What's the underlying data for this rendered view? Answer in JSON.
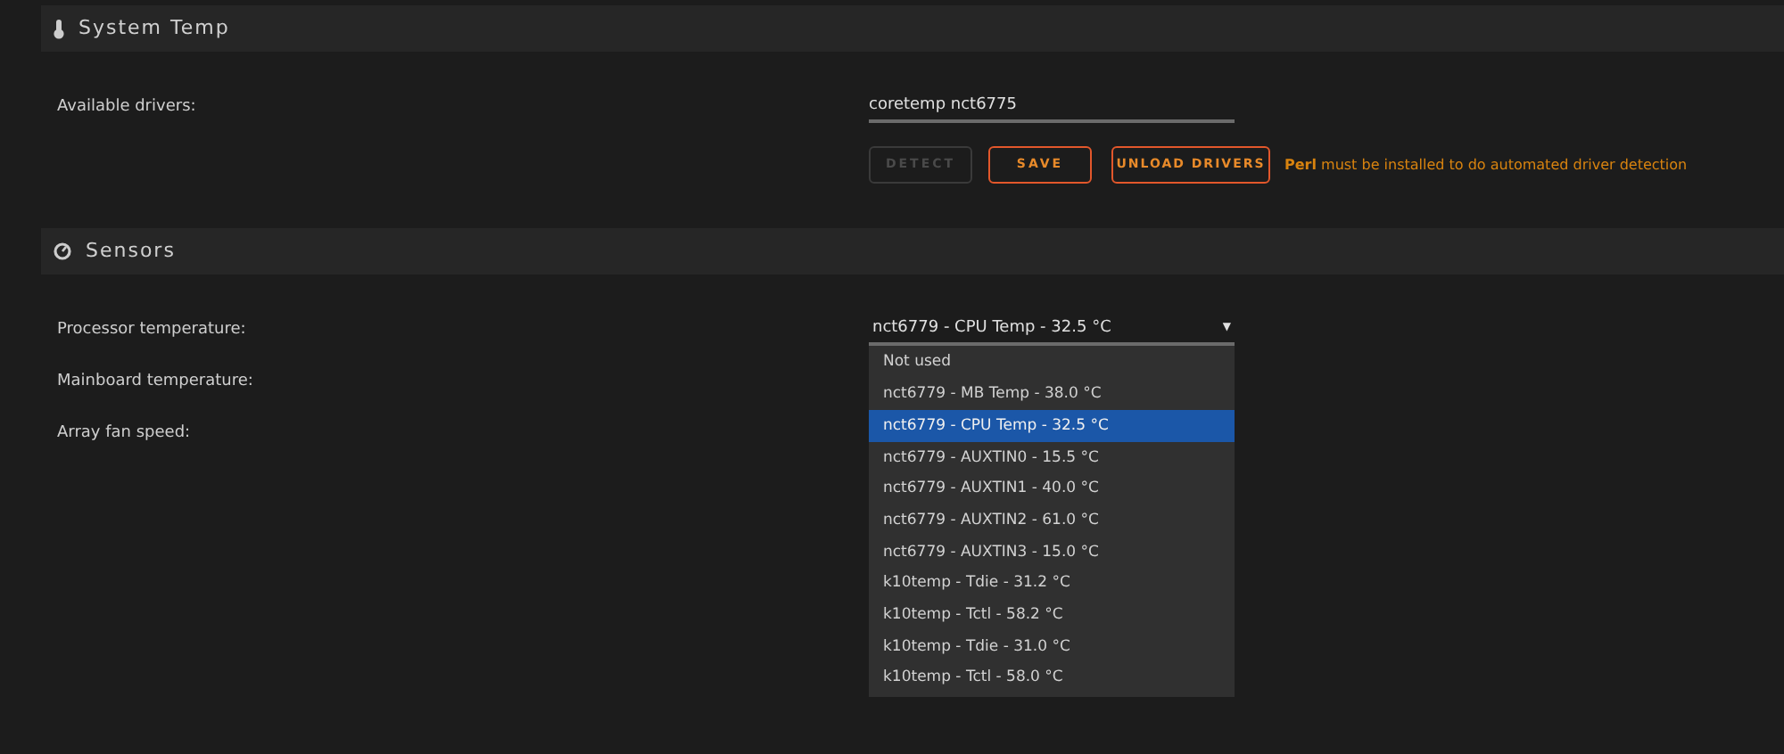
{
  "sections": [
    {
      "title": "System Temp",
      "kind": "thermometer"
    },
    {
      "title": "Sensors",
      "kind": "gauge"
    }
  ],
  "drivers": {
    "label": "Available drivers:",
    "value": "coretemp nct6775"
  },
  "buttons": [
    {
      "label": "DETECT",
      "disabled": true
    },
    {
      "label": "SAVE",
      "disabled": false
    },
    {
      "label": "UNLOAD DRIVERS",
      "disabled": false
    }
  ],
  "driver_note": "**Perl** must be installed to do automated driver detection",
  "sensors": [
    {
      "label": "Processor temperature:"
    },
    {
      "label": "Mainboard temperature:"
    },
    {
      "label": "Array fan speed:"
    }
  ],
  "select": {
    "value": "nct6779 - CPU Temp - 32.5 °C",
    "arrow": "▼",
    "options": [
      {
        "label": "Not used",
        "selected": false
      },
      {
        "label": "nct6779 - MB Temp - 38.0 °C",
        "selected": false
      },
      {
        "label": "nct6779 - CPU Temp - 32.5 °C",
        "selected": true
      },
      {
        "label": "nct6779 - AUXTIN0 - 15.5 °C",
        "selected": false
      },
      {
        "label": "nct6779 - AUXTIN1 - 40.0 °C",
        "selected": false
      },
      {
        "label": "nct6779 - AUXTIN2 - 61.0 °C",
        "selected": false
      },
      {
        "label": "nct6779 - AUXTIN3 - 15.0 °C",
        "selected": false
      },
      {
        "label": "k10temp - Tdie - 31.2 °C",
        "selected": false
      },
      {
        "label": "k10temp - Tctl - 58.2 °C",
        "selected": false
      },
      {
        "label": "k10temp - Tdie - 31.0 °C",
        "selected": false
      },
      {
        "label": "k10temp - Tctl - 58.0 °C",
        "selected": false
      }
    ]
  }
}
